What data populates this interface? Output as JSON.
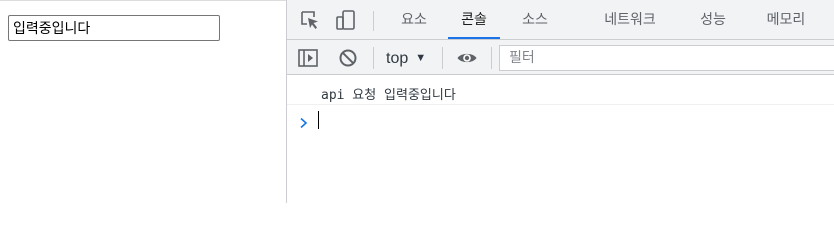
{
  "page": {
    "input_value": "입력중입니다"
  },
  "devtools": {
    "tabs": [
      {
        "label": "요소",
        "active": false
      },
      {
        "label": "콘솔",
        "active": true
      },
      {
        "label": "소스",
        "active": false
      },
      {
        "label": "네트워크",
        "active": false
      },
      {
        "label": "성능",
        "active": false
      },
      {
        "label": "메모리",
        "active": false
      }
    ],
    "toolbar": {
      "context": "top",
      "filter_placeholder": "필터"
    },
    "console": {
      "log_message": "api 요청 입력중입니다"
    },
    "icons": {
      "inspect": "inspect-element-icon",
      "device": "device-toolbar-icon",
      "sidebar": "show-sidebar-icon",
      "clear": "clear-console-icon",
      "eye": "live-expression-icon",
      "prompt": "console-prompt-chevron-icon"
    },
    "colors": {
      "accent": "#1a73e8",
      "toolbar_bg": "#f1f3f4",
      "prompt": "#1a73e8"
    }
  }
}
